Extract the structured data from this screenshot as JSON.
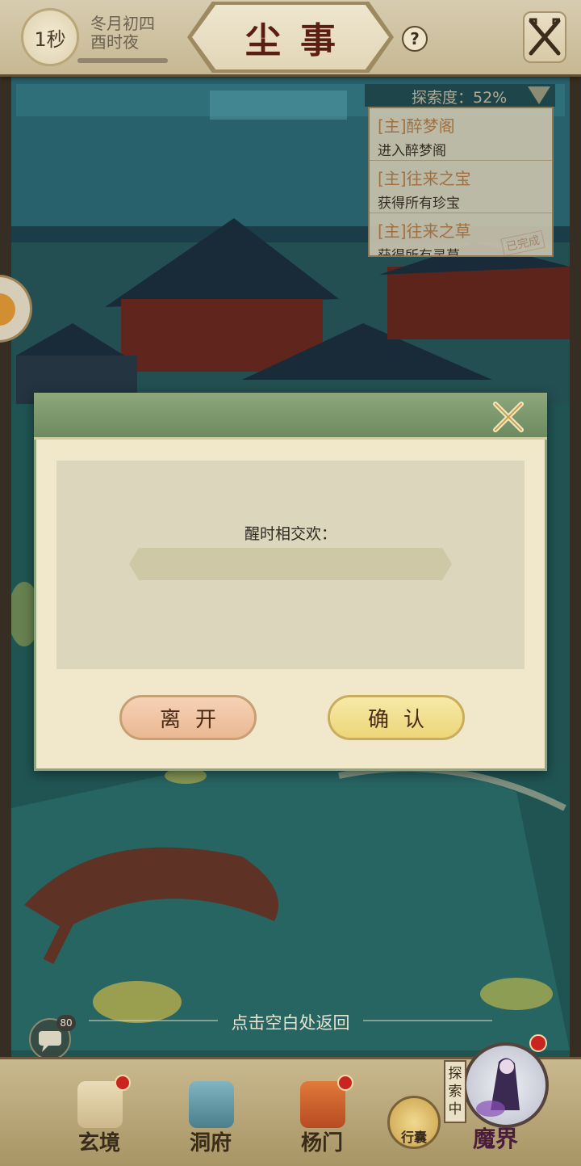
{
  "topbar": {
    "timer": "1秒",
    "date_line1": "冬月初四",
    "date_line2": "酉时夜",
    "title": "尘事",
    "help_label": "?"
  },
  "quest_panel": {
    "explore_label": "探索度：52%",
    "quests": [
      {
        "title": "[主]醉梦阁",
        "desc": "进入醉梦阁",
        "stamp": ""
      },
      {
        "title": "[主]往来之宝",
        "desc": "获得所有珍宝",
        "stamp": ""
      },
      {
        "title": "[主]往来之草",
        "desc": "获得所有灵草",
        "stamp": "已完成"
      }
    ]
  },
  "modal": {
    "prompt": "醒时相交欢：",
    "answer_value": "",
    "leave_label": "离开",
    "confirm_label": "确认"
  },
  "back_hint": "点击空白处返回",
  "chat": {
    "badge": "80"
  },
  "bottom_nav": {
    "items": [
      {
        "label": "玄境"
      },
      {
        "label": "洞府"
      },
      {
        "label": "杨门"
      }
    ],
    "bag_label": "行囊",
    "explore_tag": "探索中",
    "demon_label": "魔界"
  }
}
